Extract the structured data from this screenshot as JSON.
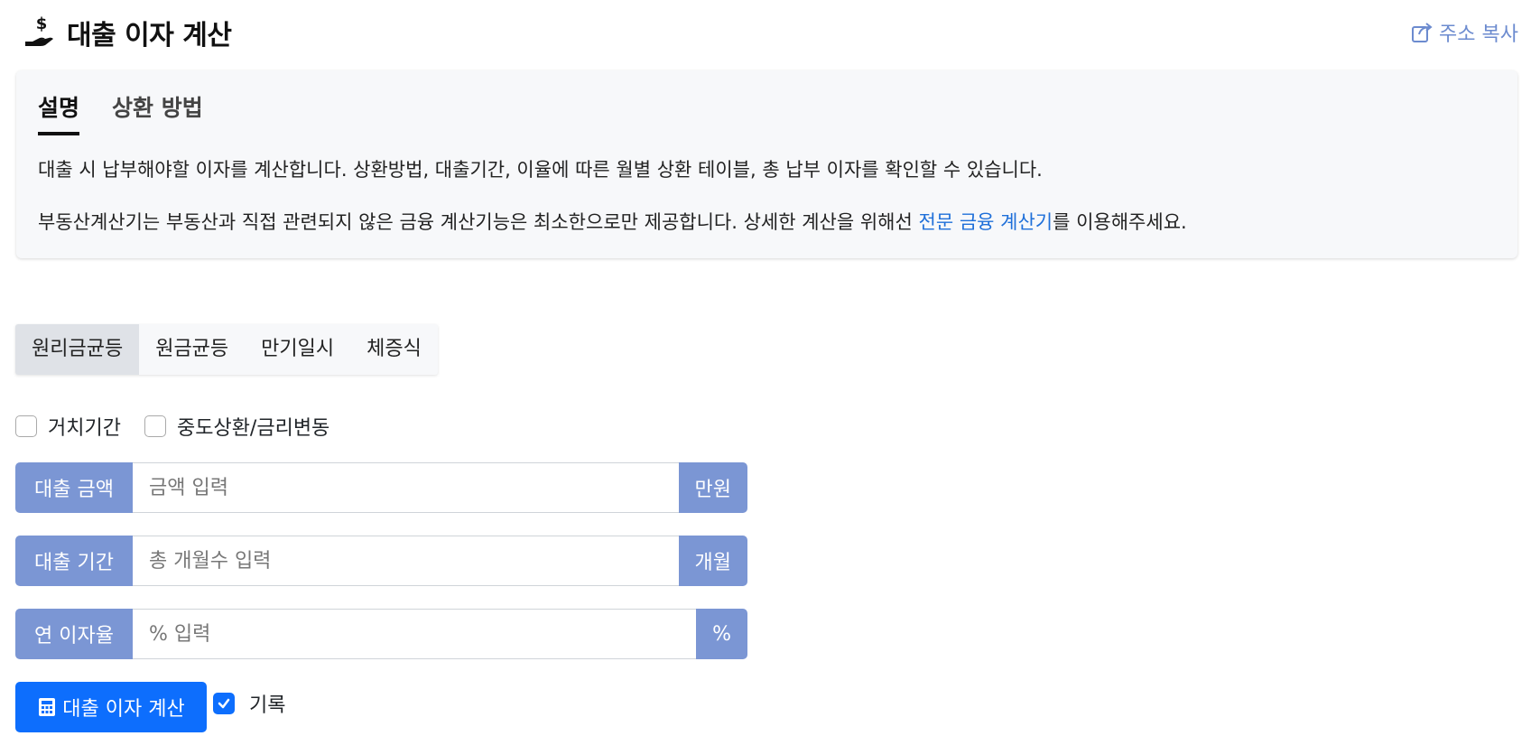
{
  "header": {
    "title": "대출 이자 계산",
    "icon": "hand-holding-dollar-icon",
    "share_label": "주소 복사"
  },
  "description": {
    "tabs": [
      "설명",
      "상환 방법"
    ],
    "active_tab": "설명",
    "paragraph1": "대출 시 납부해야할 이자를 계산합니다. 상환방법, 대출기간, 이율에 따른 월별 상환 테이블, 총 납부 이자를 확인할 수 있습니다.",
    "paragraph2_before": "부동산계산기는 부동산과 직접 관련되지 않은 금융 계산기능은 최소한으로만 제공합니다. 상세한 계산을 위해선 ",
    "paragraph2_link": "전문 금융 계산기",
    "paragraph2_after": "를 이용해주세요."
  },
  "methods": {
    "items": [
      "원리금균등",
      "원금균등",
      "만기일시",
      "체증식"
    ],
    "active": "원리금균등"
  },
  "options": {
    "grace_period": {
      "label": "거치기간",
      "checked": false
    },
    "prepayment": {
      "label": "중도상환/금리변동",
      "checked": false
    }
  },
  "fields": {
    "amount": {
      "label": "대출 금액",
      "placeholder": "금액 입력",
      "unit": "만원",
      "value": ""
    },
    "period": {
      "label": "대출 기간",
      "placeholder": "총 개월수 입력",
      "unit": "개월",
      "value": ""
    },
    "rate": {
      "label": "연 이자율",
      "placeholder": "% 입력",
      "unit": "%",
      "value": ""
    }
  },
  "actions": {
    "calculate_label": "대출 이자 계산",
    "record_label": "기록",
    "record_checked": true
  },
  "colors": {
    "accent": "#7b96d4",
    "primary": "#0d6efd",
    "link": "#1e6fd9"
  }
}
